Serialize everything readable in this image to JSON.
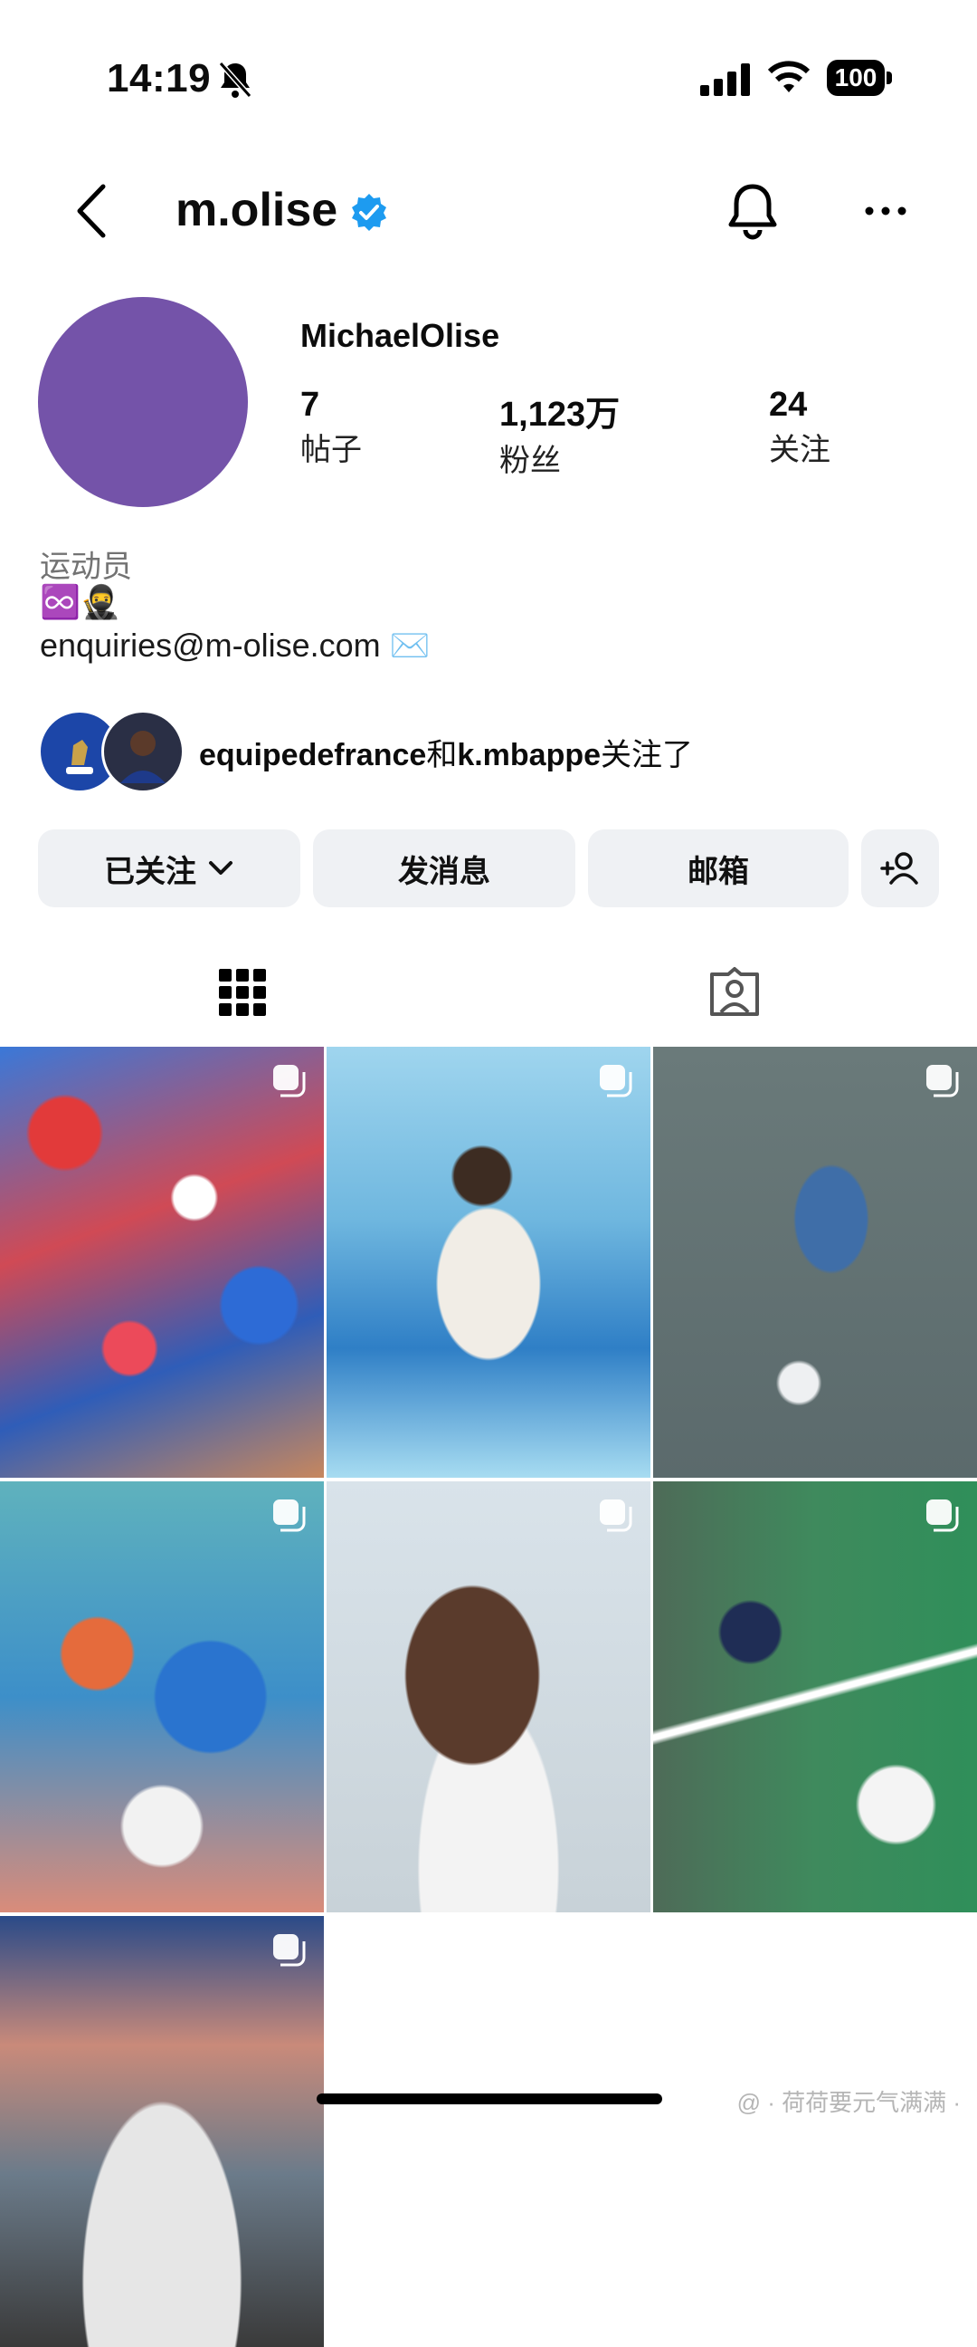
{
  "status_bar": {
    "time": "14:19",
    "battery": "100"
  },
  "header": {
    "username": "m.olise"
  },
  "profile": {
    "display_name": "MichaelOlise",
    "avatar_color": "#7453a9",
    "stats": [
      {
        "value": "7",
        "label": "帖子"
      },
      {
        "value": "1,123万",
        "label": "粉丝"
      },
      {
        "value": "24",
        "label": "关注"
      }
    ],
    "category": "运动员",
    "bio_emoji": "♾️🥷",
    "email": "enquiries@m-olise.com ✉️"
  },
  "followed_by": {
    "account_1": "equipedefrance",
    "connector": "和",
    "account_2": "k.mbappe",
    "suffix": "关注了"
  },
  "actions": {
    "following": "已关注",
    "message": "发消息",
    "email": "邮箱"
  },
  "tabs": [
    {
      "icon": "grid-icon",
      "active": true
    },
    {
      "icon": "tagged-icon",
      "active": false
    }
  ],
  "posts_count_shown": 7,
  "watermark": "@ · 荷荷要元气满满 ·",
  "colors": {
    "verified": "#1d9bf0",
    "button_bg": "#eff1f4",
    "muted_text": "#737373"
  }
}
